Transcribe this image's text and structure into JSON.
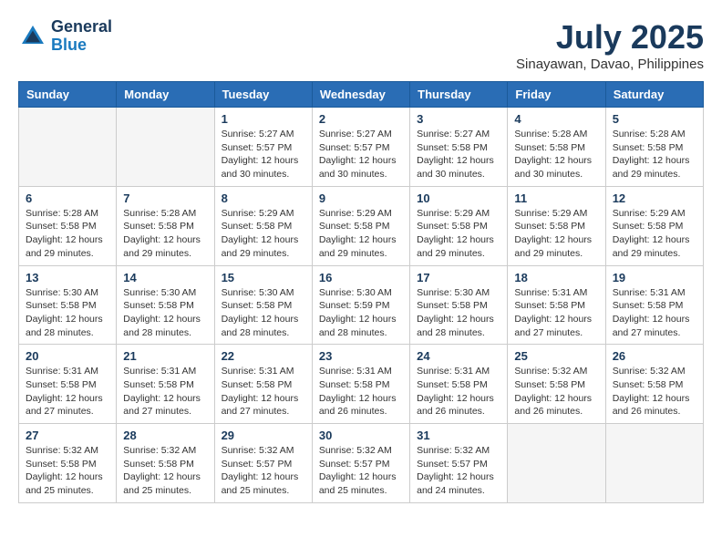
{
  "header": {
    "logo_line1": "General",
    "logo_line2": "Blue",
    "month": "July 2025",
    "location": "Sinayawan, Davao, Philippines"
  },
  "weekdays": [
    "Sunday",
    "Monday",
    "Tuesday",
    "Wednesday",
    "Thursday",
    "Friday",
    "Saturday"
  ],
  "weeks": [
    [
      {
        "day": "",
        "info": ""
      },
      {
        "day": "",
        "info": ""
      },
      {
        "day": "1",
        "info": "Sunrise: 5:27 AM\nSunset: 5:57 PM\nDaylight: 12 hours\nand 30 minutes."
      },
      {
        "day": "2",
        "info": "Sunrise: 5:27 AM\nSunset: 5:57 PM\nDaylight: 12 hours\nand 30 minutes."
      },
      {
        "day": "3",
        "info": "Sunrise: 5:27 AM\nSunset: 5:58 PM\nDaylight: 12 hours\nand 30 minutes."
      },
      {
        "day": "4",
        "info": "Sunrise: 5:28 AM\nSunset: 5:58 PM\nDaylight: 12 hours\nand 30 minutes."
      },
      {
        "day": "5",
        "info": "Sunrise: 5:28 AM\nSunset: 5:58 PM\nDaylight: 12 hours\nand 29 minutes."
      }
    ],
    [
      {
        "day": "6",
        "info": "Sunrise: 5:28 AM\nSunset: 5:58 PM\nDaylight: 12 hours\nand 29 minutes."
      },
      {
        "day": "7",
        "info": "Sunrise: 5:28 AM\nSunset: 5:58 PM\nDaylight: 12 hours\nand 29 minutes."
      },
      {
        "day": "8",
        "info": "Sunrise: 5:29 AM\nSunset: 5:58 PM\nDaylight: 12 hours\nand 29 minutes."
      },
      {
        "day": "9",
        "info": "Sunrise: 5:29 AM\nSunset: 5:58 PM\nDaylight: 12 hours\nand 29 minutes."
      },
      {
        "day": "10",
        "info": "Sunrise: 5:29 AM\nSunset: 5:58 PM\nDaylight: 12 hours\nand 29 minutes."
      },
      {
        "day": "11",
        "info": "Sunrise: 5:29 AM\nSunset: 5:58 PM\nDaylight: 12 hours\nand 29 minutes."
      },
      {
        "day": "12",
        "info": "Sunrise: 5:29 AM\nSunset: 5:58 PM\nDaylight: 12 hours\nand 29 minutes."
      }
    ],
    [
      {
        "day": "13",
        "info": "Sunrise: 5:30 AM\nSunset: 5:58 PM\nDaylight: 12 hours\nand 28 minutes."
      },
      {
        "day": "14",
        "info": "Sunrise: 5:30 AM\nSunset: 5:58 PM\nDaylight: 12 hours\nand 28 minutes."
      },
      {
        "day": "15",
        "info": "Sunrise: 5:30 AM\nSunset: 5:58 PM\nDaylight: 12 hours\nand 28 minutes."
      },
      {
        "day": "16",
        "info": "Sunrise: 5:30 AM\nSunset: 5:59 PM\nDaylight: 12 hours\nand 28 minutes."
      },
      {
        "day": "17",
        "info": "Sunrise: 5:30 AM\nSunset: 5:58 PM\nDaylight: 12 hours\nand 28 minutes."
      },
      {
        "day": "18",
        "info": "Sunrise: 5:31 AM\nSunset: 5:58 PM\nDaylight: 12 hours\nand 27 minutes."
      },
      {
        "day": "19",
        "info": "Sunrise: 5:31 AM\nSunset: 5:58 PM\nDaylight: 12 hours\nand 27 minutes."
      }
    ],
    [
      {
        "day": "20",
        "info": "Sunrise: 5:31 AM\nSunset: 5:58 PM\nDaylight: 12 hours\nand 27 minutes."
      },
      {
        "day": "21",
        "info": "Sunrise: 5:31 AM\nSunset: 5:58 PM\nDaylight: 12 hours\nand 27 minutes."
      },
      {
        "day": "22",
        "info": "Sunrise: 5:31 AM\nSunset: 5:58 PM\nDaylight: 12 hours\nand 27 minutes."
      },
      {
        "day": "23",
        "info": "Sunrise: 5:31 AM\nSunset: 5:58 PM\nDaylight: 12 hours\nand 26 minutes."
      },
      {
        "day": "24",
        "info": "Sunrise: 5:31 AM\nSunset: 5:58 PM\nDaylight: 12 hours\nand 26 minutes."
      },
      {
        "day": "25",
        "info": "Sunrise: 5:32 AM\nSunset: 5:58 PM\nDaylight: 12 hours\nand 26 minutes."
      },
      {
        "day": "26",
        "info": "Sunrise: 5:32 AM\nSunset: 5:58 PM\nDaylight: 12 hours\nand 26 minutes."
      }
    ],
    [
      {
        "day": "27",
        "info": "Sunrise: 5:32 AM\nSunset: 5:58 PM\nDaylight: 12 hours\nand 25 minutes."
      },
      {
        "day": "28",
        "info": "Sunrise: 5:32 AM\nSunset: 5:58 PM\nDaylight: 12 hours\nand 25 minutes."
      },
      {
        "day": "29",
        "info": "Sunrise: 5:32 AM\nSunset: 5:57 PM\nDaylight: 12 hours\nand 25 minutes."
      },
      {
        "day": "30",
        "info": "Sunrise: 5:32 AM\nSunset: 5:57 PM\nDaylight: 12 hours\nand 25 minutes."
      },
      {
        "day": "31",
        "info": "Sunrise: 5:32 AM\nSunset: 5:57 PM\nDaylight: 12 hours\nand 24 minutes."
      },
      {
        "day": "",
        "info": ""
      },
      {
        "day": "",
        "info": ""
      }
    ]
  ]
}
